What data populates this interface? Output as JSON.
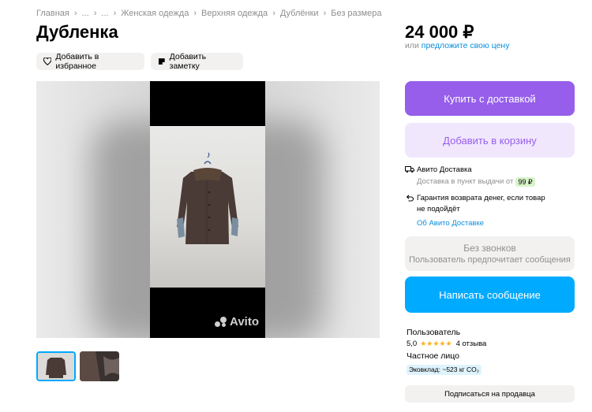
{
  "breadcrumbs": [
    "Главная",
    "...",
    "...",
    "Женская одежда",
    "Верхняя одежда",
    "Дублёнки",
    "Без размера"
  ],
  "title": "Дубленка",
  "price": "24 000 ₽",
  "offer": {
    "prefix": "или",
    "link": "предложите свою цену"
  },
  "actions": {
    "favorite": "Добавить в избранное",
    "note": "Добавить заметку"
  },
  "gallery": {
    "watermark": "Avito",
    "thumbnails_count": 2,
    "selected_thumbnail": 1
  },
  "buy_button": "Купить с доставкой",
  "cart_button": "Добавить в корзину",
  "delivery": {
    "title": "Авито Доставка",
    "pickup_text": "Доставка в пункт выдачи от",
    "pickup_price": "99 ₽",
    "guarantee_line1": "Гарантия возврата денег, если товар",
    "guarantee_line2": "не подойдёт",
    "about_link": "Об Авито Доставке"
  },
  "no_calls": {
    "title": "Без звонков",
    "subtitle": "Пользователь предпочитает сообщения"
  },
  "write_button": "Написать сообщение",
  "seller": {
    "type": "Пользователь",
    "rating": "5,0",
    "stars": "★★★★★",
    "reviews": "4 отзыва",
    "kind": "Частное лицо",
    "eco": "Эковклад: ~523 кг CO₂"
  },
  "subscribe_button": "Подписаться на продавца",
  "colors": {
    "buy": "#965eeb",
    "cart_bg": "#f1e7fd",
    "write": "#00aaff",
    "link": "#0a8edb",
    "stars": "#ffb021"
  }
}
